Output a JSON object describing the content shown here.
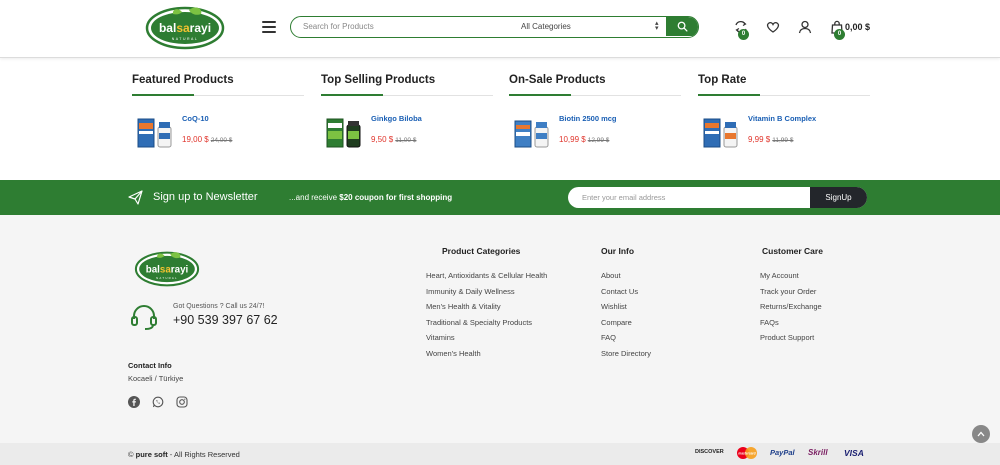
{
  "header": {
    "logo_text": "balsarayi",
    "search_placeholder": "Search for Products",
    "category_selected": "All Categories",
    "compare_count": "0",
    "cart_count": "0",
    "cart_total": "0,00 $"
  },
  "sections": [
    {
      "title": "Featured Products",
      "product": {
        "name": "CoQ-10",
        "price": "19,00 $",
        "old_price": "24,00 $"
      }
    },
    {
      "title": "Top Selling Products",
      "product": {
        "name": "Ginkgo Biloba",
        "price": "9,50 $",
        "old_price": "11,00 $"
      }
    },
    {
      "title": "On-Sale Products",
      "product": {
        "name": "Biotin 2500 mcg",
        "price": "10,99 $",
        "old_price": "12,99 $"
      }
    },
    {
      "title": "Top Rate",
      "product": {
        "name": "Vitamin B Complex",
        "price": "9,99 $",
        "old_price": "11,99 $"
      }
    }
  ],
  "newsletter": {
    "title": "Sign up to Newsletter",
    "sub_prefix": "...and receive ",
    "sub_bold": "$20 coupon for first shopping",
    "placeholder": "Enter your email address",
    "button": "SignUp"
  },
  "footer": {
    "support_question": "Got Questions ? Call us 24/7!",
    "phone": "+90 539 397 67 62",
    "contact_heading": "Contact Info",
    "contact_value": "Kocaeli / Türkiye",
    "columns": [
      {
        "heading": "Product Categories",
        "items": [
          "Heart, Antioxidants & Cellular Health",
          "Immunity & Daily Wellness",
          "Men's Health & Vitality",
          "Traditional & Specialty Products",
          "Vitamins",
          "Women's Health"
        ]
      },
      {
        "heading": "Our Info",
        "items": [
          "About",
          "Contact Us",
          "Wishlist",
          "Compare",
          "FAQ",
          "Store Directory"
        ]
      },
      {
        "heading": "Customer Care",
        "items": [
          "My Account",
          "Track your Order",
          "Returns/Exchange",
          "FAQs",
          "Product Support"
        ]
      }
    ]
  },
  "bottom": {
    "brand": "pure soft",
    "rights": " - All Rights Reserved",
    "payments": [
      "DISCOVER",
      "mastercard",
      "PayPal",
      "Skrill",
      "VISA"
    ]
  },
  "colors": {
    "brand_green": "#2e7d32",
    "price_red": "#e0342b",
    "link_blue": "#1a5fb4"
  }
}
